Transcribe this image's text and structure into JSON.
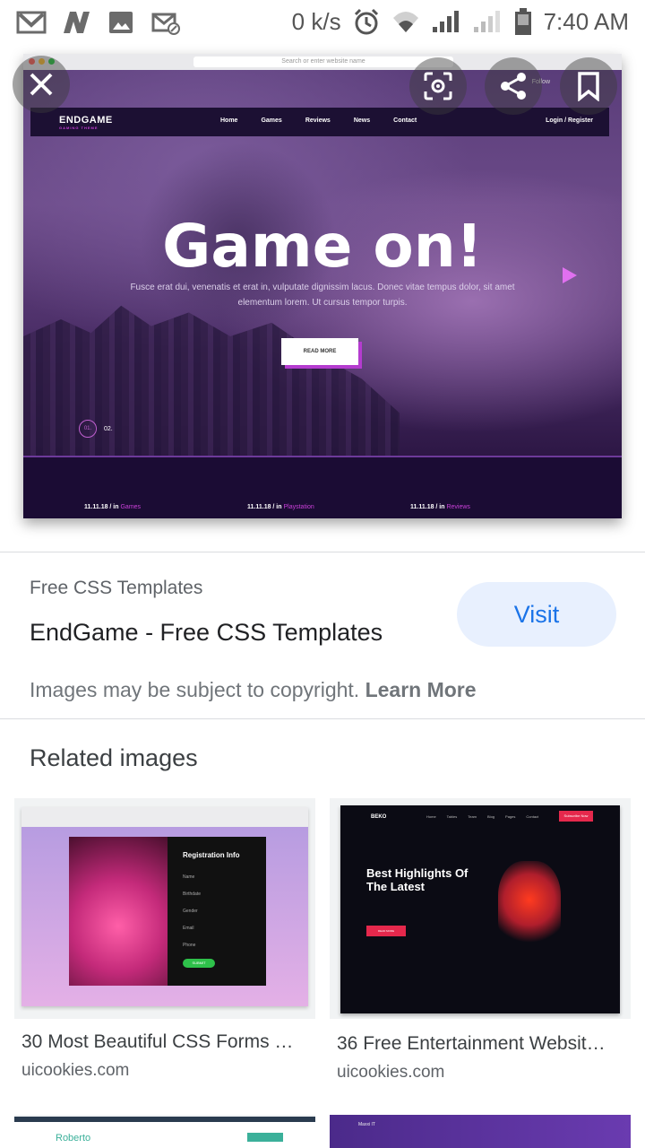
{
  "status_bar": {
    "speed": "0 k/s",
    "time": "7:40 AM",
    "icons": [
      "gmail-icon",
      "n-app-icon",
      "image-icon",
      "message-blocked-icon",
      "alarm-icon",
      "wifi-icon",
      "signal-icon",
      "signal-weak-icon",
      "battery-icon"
    ]
  },
  "preview": {
    "url_placeholder": "Search or enter website name",
    "logo": "ENDGAME",
    "logo_tag": "GAMING THEME",
    "nav": [
      "Home",
      "Games",
      "Reviews",
      "News",
      "Contact"
    ],
    "login": "Login / Register",
    "follow": "Follow",
    "headline": "Game on!",
    "subtext": "Fusce erat dui, venenatis et erat in, vulputate dignissim lacus. Donec vitae tempus dolor, sit amet elementum lorem. Ut cursus tempor turpis.",
    "button": "READ MORE",
    "pager_current": "01.",
    "pager_next": "02.",
    "footer_items": [
      {
        "date": "11.11.18 / in",
        "tag": "Games"
      },
      {
        "date": "11.11.18 / in",
        "tag": "Playstation"
      },
      {
        "date": "11.11.18 / in",
        "tag": "Reviews"
      }
    ]
  },
  "overlay": {
    "close": "close-icon",
    "lens": "lens-icon",
    "share": "share-icon",
    "bookmark": "bookmark-icon"
  },
  "info": {
    "source": "Free CSS Templates",
    "title": "EndGame - Free CSS Templates",
    "visit": "Visit",
    "copyright": "Images may be subject to copyright.",
    "learn_more": "Learn More"
  },
  "related": {
    "heading": "Related images",
    "items": [
      {
        "caption": "30 Most Beautiful CSS Forms …",
        "domain": "uicookies.com",
        "form_title": "Registration Info",
        "fields": [
          "Name",
          "Birthdate",
          "Gender",
          "Email",
          "Phone"
        ],
        "submit": "SUBMIT"
      },
      {
        "caption": "36 Free Entertainment Websit…",
        "domain": "uicookies.com",
        "brand": "BEKO",
        "headline": "Best Highlights Of The Latest",
        "nav": [
          "Home",
          "Tables",
          "Team",
          "Blog",
          "Pages",
          "Contact"
        ],
        "cta": "Subscribe Now",
        "btn": "READ MORE"
      },
      {
        "brand": "Roberto"
      },
      {
        "brand": "Maxxi IT"
      }
    ]
  },
  "colors": {
    "accent": "#1a73e8",
    "visit_bg": "#e8f0fe",
    "purple": "#c940d8"
  }
}
